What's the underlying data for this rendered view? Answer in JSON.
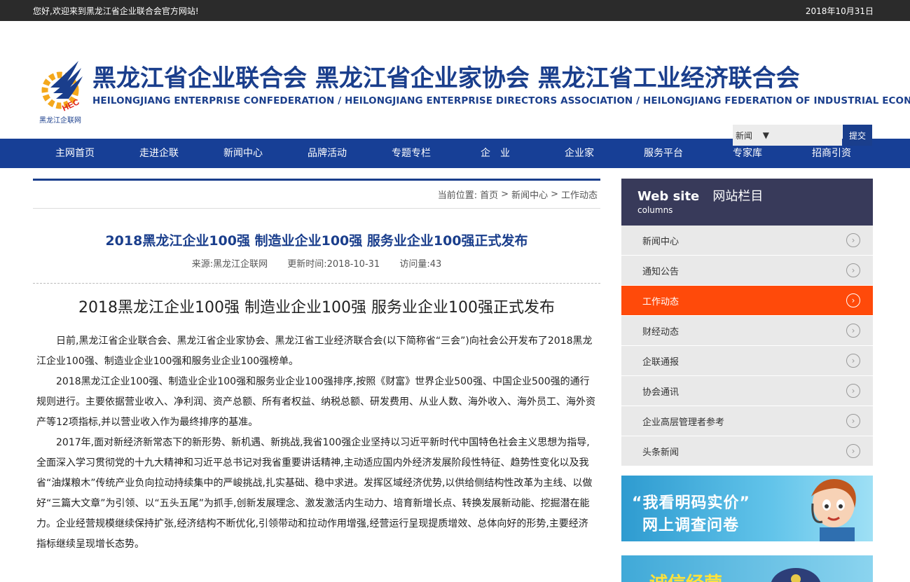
{
  "topbar": {
    "welcome": "您好,欢迎来到黑龙江省企业联合会官方网站!",
    "date": "2018年10月31日"
  },
  "header": {
    "logo_caption": "黑龙江企联网",
    "logo_letters": "HEC",
    "title_cn": "黑龙江省企业联合会 黑龙江省企业家协会 黑龙江省工业经济联合会",
    "title_en": "HEILONGJIANG ENTERPRISE CONFEDERATION / HEILONGJIANG ENTERPRISE DIRECTORS ASSOCIATION / HEILONGJIANG FEDERATION OF INDUSTRIAL ECONOMICS"
  },
  "search": {
    "selected": "新闻",
    "button": "提交",
    "value": ""
  },
  "nav": [
    "主网首页",
    "走进企联",
    "新闻中心",
    "品牌活动",
    "专题专栏",
    "企　业",
    "企业家",
    "服务平台",
    "专家库",
    "招商引资"
  ],
  "breadcrumb": {
    "prefix": "当前位置:",
    "items": [
      "首页",
      ">",
      "新闻中心",
      ">",
      "工作动态"
    ]
  },
  "article": {
    "title": "2018黑龙江企业100强 制造业企业100强 服务业企业100强正式发布",
    "source": "来源:黑龙江企联网",
    "updated": "更新时间:2018-10-31",
    "views": "访问量:43",
    "big_title": "2018黑龙江企业100强 制造业企业100强 服务业企业100强正式发布",
    "paragraphs": [
      "日前,黑龙江省企业联合会、黑龙江省企业家协会、黑龙江省工业经济联合会(以下简称省“三会”)向社会公开发布了2018黑龙江企业100强、制造业企业100强和服务业企业100强榜单。",
      "2018黑龙江企业100强、制造业企业100强和服务业企业100强排序,按照《财富》世界企业500强、中国企业500强的通行规则进行。主要依据营业收入、净利润、资产总额、所有者权益、纳税总额、研发费用、从业人数、海外收入、海外员工、海外资产等12项指标,并以营业收入作为最终排序的基准。",
      "2017年,面对新经济新常态下的新形势、新机遇、新挑战,我省100强企业坚持以习近平新时代中国特色社会主义思想为指导,全面深入学习贯彻党的十九大精神和习近平总书记对我省重要讲话精神,主动适应国内外经济发展阶段性特征、趋势性变化以及我省“油煤粮木”传统产业负向拉动持续集中的严峻挑战,扎实基础、稳中求进。发挥区域经济优势,以供给侧结构性改革为主线、以做好“三篇大文章”为引领、以“五头五尾”为抓手,创新发展理念、激发激活内生动力、培育新增长点、转换发展新动能、挖掘潜在能力。企业经营规模继续保持扩张,经济结构不断优化,引领带动和拉动作用增强,经营运行呈现提质增效、总体向好的形势,主要经济指标继续呈现增长态势。"
    ]
  },
  "sidebar": {
    "title_en": "Web site",
    "title_cn": "网站栏目",
    "subtitle": "columns",
    "items": [
      {
        "label": "新闻中心",
        "active": false
      },
      {
        "label": "通知公告",
        "active": false
      },
      {
        "label": "工作动态",
        "active": true
      },
      {
        "label": "财经动态",
        "active": false
      },
      {
        "label": "企联通报",
        "active": false
      },
      {
        "label": "协会通讯",
        "active": false
      },
      {
        "label": "企业高层管理者参考",
        "active": false
      },
      {
        "label": "头条新闻",
        "active": false
      }
    ],
    "banner1_line1": "“我看明码实价”",
    "banner1_line2": "网上调查问卷",
    "banner2_text": "诚信经营"
  },
  "colors": {
    "brand_blue": "#1a3e8c",
    "nav_blue": "#173f96",
    "active_orange": "#ff4a0a",
    "sidebar_head": "#383a5a"
  }
}
